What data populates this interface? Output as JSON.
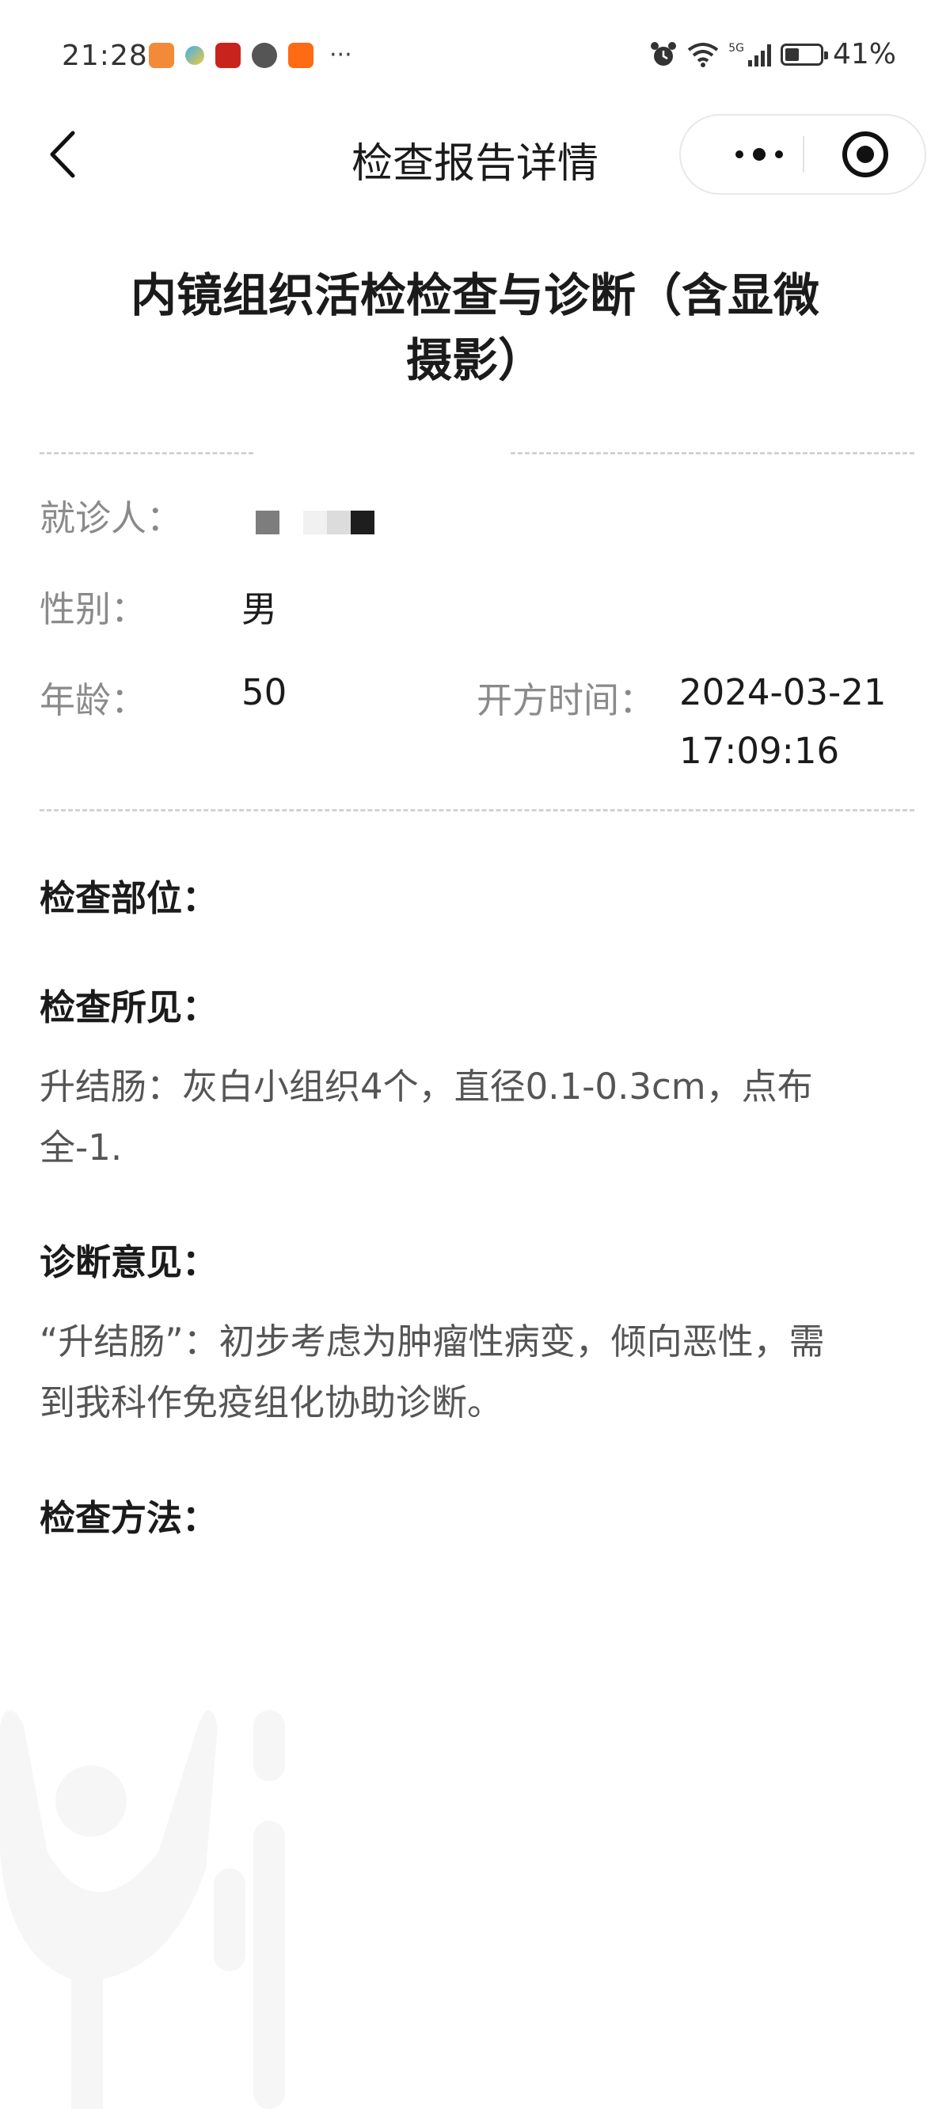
{
  "status_bar": {
    "time": "21:28",
    "more": "···",
    "battery_percent": "41%",
    "battery_level": 0.41,
    "icons": [
      "alarm-icon",
      "wifi-icon",
      "signal-5g-icon",
      "battery-icon"
    ]
  },
  "nav": {
    "title": "检查报告详情"
  },
  "report": {
    "title_line1": "内镜组织活检检查与诊断（含显微",
    "title_line2": "摄影）",
    "patient_label": "就诊人：",
    "gender_label": "性别：",
    "gender_value": "男",
    "age_label": "年龄：",
    "age_value": "50",
    "time_label": "开方时间：",
    "time_date": "2024-03-21",
    "time_clock": "17:09:16",
    "site_label": "检查部位：",
    "findings_label": "检查所见：",
    "findings_line1": "升结肠：灰白小组织4个，直径0.1-0.3cm，点布",
    "findings_line2": "全-1.",
    "diagnosis_label": "诊断意见：",
    "diagnosis_line1": "“升结肠”：初步考虑为肿瘤性病变，倾向恶性，需",
    "diagnosis_line2": "到我科作免疫组化协助诊断。",
    "method_label": "检查方法："
  },
  "colors": {
    "label": "#8a8a8a",
    "text": "#1b1b1b",
    "paragraph": "#555555",
    "divider": "#d2d2d2"
  }
}
